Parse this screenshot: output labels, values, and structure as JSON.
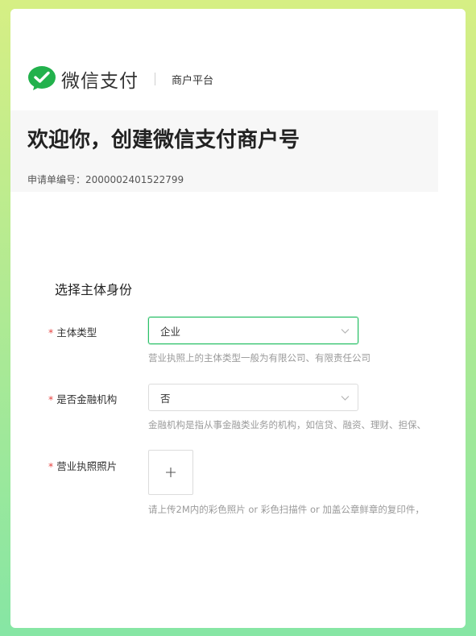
{
  "header": {
    "brand_name": "微信支付",
    "brand_sub": "商户平台",
    "logo_icon": "wechat-pay-logo-icon",
    "accent_color": "#2bc168"
  },
  "hero": {
    "title": "欢迎你，创建微信支付商户号",
    "application_no": "申请单编号：2000002401522799"
  },
  "form": {
    "section_title": "选择主体身份",
    "required_mark": "*",
    "entity_type": {
      "label": "主体类型",
      "value": "企业",
      "hint": "营业执照上的主体类型一般为有限公司、有限责任公司"
    },
    "financial": {
      "label": "是否金融机构",
      "value": "否",
      "hint": "金融机构是指从事金融类业务的机构，如信贷、融资、理财、担保、"
    },
    "license": {
      "label": "营业执照照片",
      "upload_symbol": "+",
      "hint": "请上传2M内的彩色照片 or 彩色扫描件 or 加盖公章鲜章的复印件，"
    }
  }
}
